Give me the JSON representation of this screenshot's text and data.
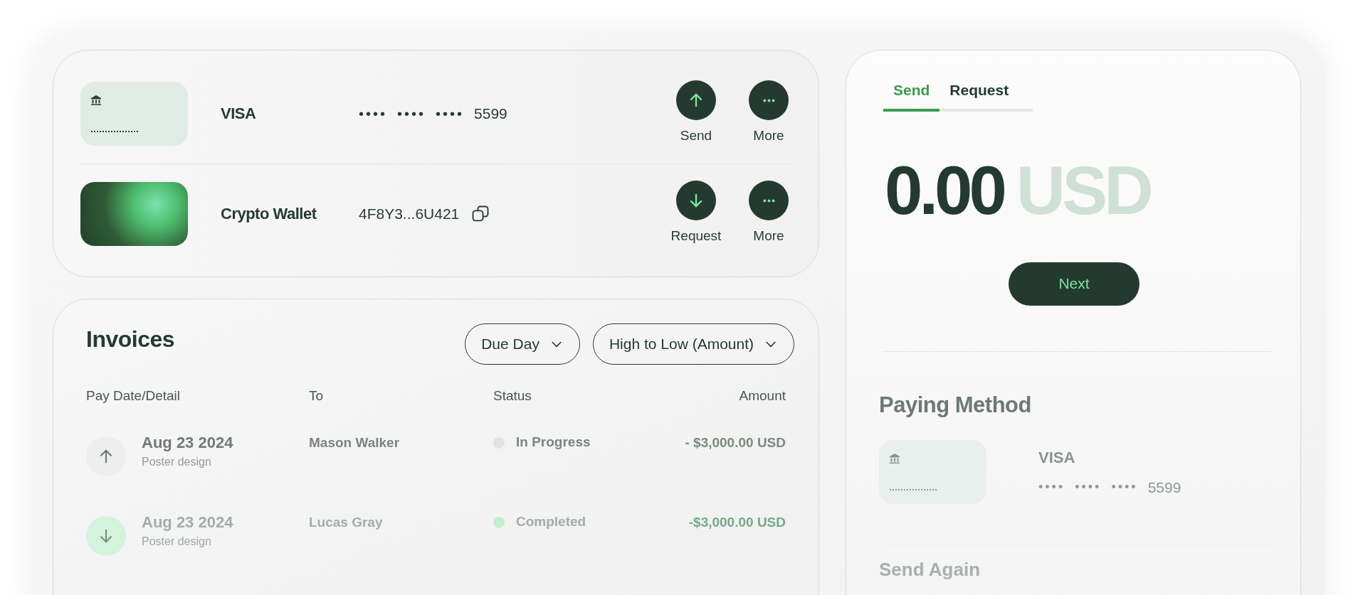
{
  "accounts": [
    {
      "kind": "card",
      "name": "VISA",
      "number_groups": [
        "••••",
        "••••",
        "••••"
      ],
      "number_last": "5599",
      "actions": [
        {
          "kind": "send",
          "label": "Send"
        },
        {
          "kind": "more",
          "label": "More"
        }
      ]
    },
    {
      "kind": "crypto",
      "name": "Crypto Wallet",
      "address": "4F8Y3...6U421",
      "actions": [
        {
          "kind": "request",
          "label": "Request"
        },
        {
          "kind": "more",
          "label": "More"
        }
      ]
    }
  ],
  "invoices": {
    "title": "Invoices",
    "filters": [
      "Due Day",
      "High to Low (Amount)"
    ],
    "columns": [
      "Pay Date/Detail",
      "To",
      "Status",
      "Amount"
    ],
    "rows": [
      {
        "kind": "outgoing",
        "date": "Aug 23 2024",
        "detail": "Poster design",
        "to": "Mason Walker",
        "status": "In Progress",
        "color": "#dfe3e1",
        "amount": "- $3,000.00 USD"
      },
      {
        "kind": "incoming",
        "date": "Aug 23 2024",
        "detail": "Poster design",
        "to": "Lucas Gray",
        "status": "Completed",
        "color": "#c3efcf",
        "amount": "-$3,000.00 USD"
      }
    ]
  },
  "transfer": {
    "tabs": [
      {
        "label": "Send",
        "selected": true
      },
      {
        "label": "Request",
        "selected": false
      }
    ],
    "amount": "0.00",
    "currency": "USD",
    "next_button": "Next",
    "paying_method": {
      "title": "Paying Method",
      "card_name": "VISA",
      "number_groups": [
        "••••",
        "••••",
        "••••"
      ],
      "number_last": "5599"
    },
    "send_again_title": "Send Again"
  }
}
